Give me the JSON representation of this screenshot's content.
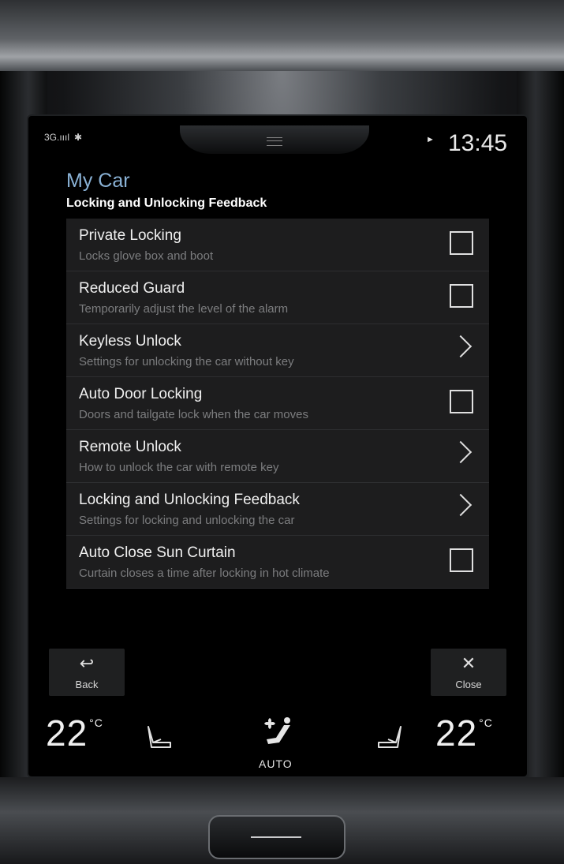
{
  "status": {
    "network": "3G",
    "signal": ".ıııl",
    "bluetooth": "✱",
    "media_state": "►",
    "time": "13:45"
  },
  "header": {
    "app_title": "My Car",
    "page_title": "Locking and Unlocking Feedback"
  },
  "settings": [
    {
      "title": "Private Locking",
      "subtitle": "Locks glove box and boot",
      "control": "checkbox",
      "checked": false
    },
    {
      "title": "Reduced Guard",
      "subtitle": "Temporarily adjust the level of the alarm",
      "control": "checkbox",
      "checked": false
    },
    {
      "title": "Keyless Unlock",
      "subtitle": "Settings for unlocking the car without key",
      "control": "chevron"
    },
    {
      "title": "Auto Door Locking",
      "subtitle": "Doors and tailgate lock when the car moves",
      "control": "checkbox",
      "checked": false
    },
    {
      "title": "Remote Unlock",
      "subtitle": "How to unlock the car with remote key",
      "control": "chevron"
    },
    {
      "title": "Locking and Unlocking Feedback",
      "subtitle": "Settings for locking and unlocking the car",
      "control": "chevron"
    },
    {
      "title": "Auto Close Sun Curtain",
      "subtitle": "Curtain closes a time after locking in hot climate",
      "control": "checkbox",
      "checked": false
    }
  ],
  "buttons": {
    "back_label": "Back",
    "close_label": "Close",
    "back_icon": "↩",
    "close_icon": "✕"
  },
  "climate": {
    "left_temp": "22",
    "right_temp": "22",
    "unit": "°C",
    "fan_mode": "AUTO"
  },
  "colors": {
    "accent": "#8ab2d6",
    "text": "#f0f0f0",
    "subtext": "#7c7d7f",
    "row_bg": "#1d1d1e"
  }
}
